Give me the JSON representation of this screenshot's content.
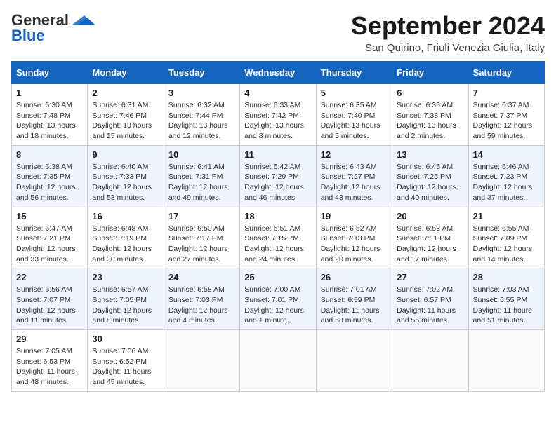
{
  "header": {
    "logo_general": "General",
    "logo_blue": "Blue",
    "month_title": "September 2024",
    "location": "San Quirino, Friuli Venezia Giulia, Italy"
  },
  "days_of_week": [
    "Sunday",
    "Monday",
    "Tuesday",
    "Wednesday",
    "Thursday",
    "Friday",
    "Saturday"
  ],
  "weeks": [
    [
      {
        "day": "1",
        "sunrise": "6:30 AM",
        "sunset": "7:48 PM",
        "daylight": "13 hours and 18 minutes."
      },
      {
        "day": "2",
        "sunrise": "6:31 AM",
        "sunset": "7:46 PM",
        "daylight": "13 hours and 15 minutes."
      },
      {
        "day": "3",
        "sunrise": "6:32 AM",
        "sunset": "7:44 PM",
        "daylight": "13 hours and 12 minutes."
      },
      {
        "day": "4",
        "sunrise": "6:33 AM",
        "sunset": "7:42 PM",
        "daylight": "13 hours and 8 minutes."
      },
      {
        "day": "5",
        "sunrise": "6:35 AM",
        "sunset": "7:40 PM",
        "daylight": "13 hours and 5 minutes."
      },
      {
        "day": "6",
        "sunrise": "6:36 AM",
        "sunset": "7:38 PM",
        "daylight": "13 hours and 2 minutes."
      },
      {
        "day": "7",
        "sunrise": "6:37 AM",
        "sunset": "7:37 PM",
        "daylight": "12 hours and 59 minutes."
      }
    ],
    [
      {
        "day": "8",
        "sunrise": "6:38 AM",
        "sunset": "7:35 PM",
        "daylight": "12 hours and 56 minutes."
      },
      {
        "day": "9",
        "sunrise": "6:40 AM",
        "sunset": "7:33 PM",
        "daylight": "12 hours and 53 minutes."
      },
      {
        "day": "10",
        "sunrise": "6:41 AM",
        "sunset": "7:31 PM",
        "daylight": "12 hours and 49 minutes."
      },
      {
        "day": "11",
        "sunrise": "6:42 AM",
        "sunset": "7:29 PM",
        "daylight": "12 hours and 46 minutes."
      },
      {
        "day": "12",
        "sunrise": "6:43 AM",
        "sunset": "7:27 PM",
        "daylight": "12 hours and 43 minutes."
      },
      {
        "day": "13",
        "sunrise": "6:45 AM",
        "sunset": "7:25 PM",
        "daylight": "12 hours and 40 minutes."
      },
      {
        "day": "14",
        "sunrise": "6:46 AM",
        "sunset": "7:23 PM",
        "daylight": "12 hours and 37 minutes."
      }
    ],
    [
      {
        "day": "15",
        "sunrise": "6:47 AM",
        "sunset": "7:21 PM",
        "daylight": "12 hours and 33 minutes."
      },
      {
        "day": "16",
        "sunrise": "6:48 AM",
        "sunset": "7:19 PM",
        "daylight": "12 hours and 30 minutes."
      },
      {
        "day": "17",
        "sunrise": "6:50 AM",
        "sunset": "7:17 PM",
        "daylight": "12 hours and 27 minutes."
      },
      {
        "day": "18",
        "sunrise": "6:51 AM",
        "sunset": "7:15 PM",
        "daylight": "12 hours and 24 minutes."
      },
      {
        "day": "19",
        "sunrise": "6:52 AM",
        "sunset": "7:13 PM",
        "daylight": "12 hours and 20 minutes."
      },
      {
        "day": "20",
        "sunrise": "6:53 AM",
        "sunset": "7:11 PM",
        "daylight": "12 hours and 17 minutes."
      },
      {
        "day": "21",
        "sunrise": "6:55 AM",
        "sunset": "7:09 PM",
        "daylight": "12 hours and 14 minutes."
      }
    ],
    [
      {
        "day": "22",
        "sunrise": "6:56 AM",
        "sunset": "7:07 PM",
        "daylight": "12 hours and 11 minutes."
      },
      {
        "day": "23",
        "sunrise": "6:57 AM",
        "sunset": "7:05 PM",
        "daylight": "12 hours and 8 minutes."
      },
      {
        "day": "24",
        "sunrise": "6:58 AM",
        "sunset": "7:03 PM",
        "daylight": "12 hours and 4 minutes."
      },
      {
        "day": "25",
        "sunrise": "7:00 AM",
        "sunset": "7:01 PM",
        "daylight": "12 hours and 1 minute."
      },
      {
        "day": "26",
        "sunrise": "7:01 AM",
        "sunset": "6:59 PM",
        "daylight": "11 hours and 58 minutes."
      },
      {
        "day": "27",
        "sunrise": "7:02 AM",
        "sunset": "6:57 PM",
        "daylight": "11 hours and 55 minutes."
      },
      {
        "day": "28",
        "sunrise": "7:03 AM",
        "sunset": "6:55 PM",
        "daylight": "11 hours and 51 minutes."
      }
    ],
    [
      {
        "day": "29",
        "sunrise": "7:05 AM",
        "sunset": "6:53 PM",
        "daylight": "11 hours and 48 minutes."
      },
      {
        "day": "30",
        "sunrise": "7:06 AM",
        "sunset": "6:52 PM",
        "daylight": "11 hours and 45 minutes."
      },
      null,
      null,
      null,
      null,
      null
    ]
  ],
  "labels": {
    "sunrise": "Sunrise:",
    "sunset": "Sunset:",
    "daylight": "Daylight:"
  }
}
